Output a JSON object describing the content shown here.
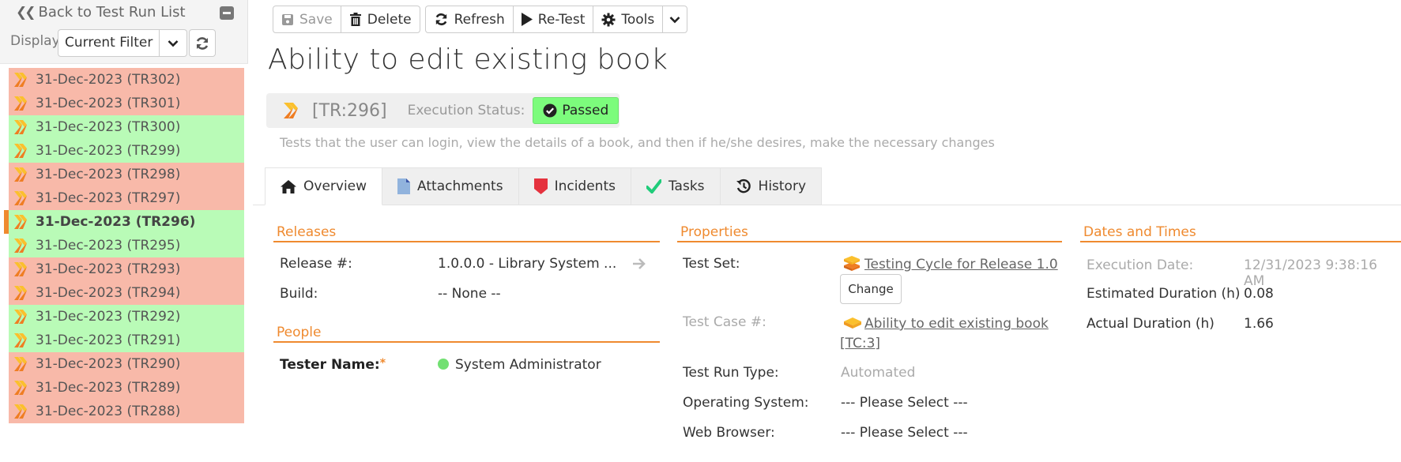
{
  "sidebar": {
    "back_label": "Back to Test Run List",
    "display_label": "Display:",
    "filter_value": "Current Filter",
    "runs": [
      {
        "label": "31-Dec-2023 (TR302)",
        "status": "fail"
      },
      {
        "label": "31-Dec-2023 (TR301)",
        "status": "fail"
      },
      {
        "label": "31-Dec-2023 (TR300)",
        "status": "pass"
      },
      {
        "label": "31-Dec-2023 (TR299)",
        "status": "pass"
      },
      {
        "label": "31-Dec-2023 (TR298)",
        "status": "fail"
      },
      {
        "label": "31-Dec-2023 (TR297)",
        "status": "fail"
      },
      {
        "label": "31-Dec-2023 (TR296)",
        "status": "pass",
        "selected": true
      },
      {
        "label": "31-Dec-2023 (TR295)",
        "status": "pass"
      },
      {
        "label": "31-Dec-2023 (TR293)",
        "status": "fail"
      },
      {
        "label": "31-Dec-2023 (TR294)",
        "status": "fail"
      },
      {
        "label": "31-Dec-2023 (TR292)",
        "status": "pass"
      },
      {
        "label": "31-Dec-2023 (TR291)",
        "status": "pass"
      },
      {
        "label": "31-Dec-2023 (TR290)",
        "status": "fail"
      },
      {
        "label": "31-Dec-2023 (TR289)",
        "status": "fail"
      },
      {
        "label": "31-Dec-2023 (TR288)",
        "status": "fail"
      }
    ]
  },
  "toolbar": {
    "save": "Save",
    "delete": "Delete",
    "refresh": "Refresh",
    "retest": "Re-Test",
    "tools": "Tools"
  },
  "header": {
    "title": "Ability to edit existing book",
    "tr_id": "[TR:296]",
    "exec_status_label": "Execution Status:",
    "exec_status": "Passed",
    "description": "Tests that the user can login, view the details of a book, and then if he/she desires, make the necessary changes"
  },
  "tabs": [
    {
      "label": "Overview",
      "icon": "home-icon",
      "active": true
    },
    {
      "label": "Attachments",
      "icon": "document-icon"
    },
    {
      "label": "Incidents",
      "icon": "bug-shield-icon"
    },
    {
      "label": "Tasks",
      "icon": "checkmark-icon"
    },
    {
      "label": "History",
      "icon": "history-icon"
    }
  ],
  "releases": {
    "heading": "Releases",
    "release_label": "Release #:",
    "release_value": "1.0.0.0 - Library System ...",
    "build_label": "Build:",
    "build_value": "-- None --"
  },
  "people": {
    "heading": "People",
    "tester_label": "Tester Name:",
    "tester_required": "*",
    "tester_value": "System Administrator"
  },
  "properties": {
    "heading": "Properties",
    "test_set_label": "Test Set:",
    "test_set_value": "Testing Cycle for Release 1.0",
    "change_label": "Change",
    "test_case_label": "Test Case #:",
    "test_case_value": "Ability to edit existing book",
    "test_case_id": "[TC:3]",
    "run_type_label": "Test Run Type:",
    "run_type_value": "Automated",
    "os_label": "Operating System:",
    "os_value": "--- Please Select ---",
    "browser_label": "Web Browser:",
    "browser_value": "--- Please Select ---"
  },
  "dates": {
    "heading": "Dates and Times",
    "exec_date_label": "Execution Date:",
    "exec_date_value": "12/31/2023 9:38:16 AM",
    "est_label": "Estimated Duration (h)",
    "est_value": "0.08",
    "actual_label": "Actual Duration (h)",
    "actual_value": "1.66"
  },
  "colors": {
    "accent": "#ef8a2f",
    "pass_row": "#b9fbb7",
    "fail_row": "#f8b9a9",
    "passed_badge": "#7cfc7c"
  }
}
